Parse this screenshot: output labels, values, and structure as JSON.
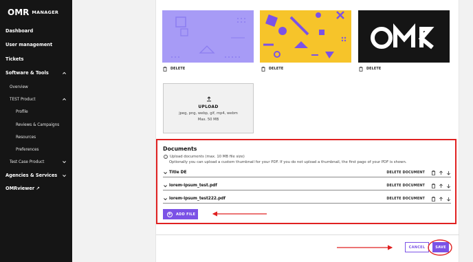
{
  "brand": {
    "mark": "OMR",
    "sub": "MANAGER"
  },
  "sidebar": {
    "items": [
      {
        "label": "Dashboard"
      },
      {
        "label": "User management"
      },
      {
        "label": "Tickets"
      },
      {
        "label": "Software & Tools"
      },
      {
        "label": "Overview"
      },
      {
        "label": "TEST Product"
      },
      {
        "label": "Profile"
      },
      {
        "label": "Reviews & Campaigns"
      },
      {
        "label": "Resources"
      },
      {
        "label": "Preferences"
      },
      {
        "label": "Test Case Product"
      },
      {
        "label": "Agencies & Services"
      },
      {
        "label": "OMRviewer ↗"
      }
    ]
  },
  "media": {
    "delete_label": "DELETE",
    "thumbs": [
      {
        "name": "purple-pattern",
        "color": "#a79bf6"
      },
      {
        "name": "yellow-pattern",
        "color": "#f6c42a"
      },
      {
        "name": "omr-logo",
        "color": "#111111",
        "logo_text": "OMR"
      }
    ],
    "upload": {
      "title": "UPLOAD",
      "types": "jpeg, png, webp, gif, mp4, webm",
      "max": "Max. 50 MB"
    }
  },
  "documents": {
    "title": "Documents",
    "info_line1": "Upload documents (max. 10 MB file size)",
    "info_line2": "Optionally you can upload a custom thumbnail for your PDF. If you do not upload a thumbnail, the first page of your PDF is shown.",
    "delete_label": "DELETE DOCUMENT",
    "rows": [
      {
        "name": "Title DE"
      },
      {
        "name": "lorem-ipsum_test.pdf"
      },
      {
        "name": "lorem-ipsum_test222.pdf"
      }
    ],
    "add_file_label": "ADD FILE"
  },
  "footer": {
    "cancel_label": "CANCEL",
    "save_label": "SAVE"
  },
  "colors": {
    "accent": "#7b52e6",
    "highlight": "#e02020",
    "sidebar": "#151515"
  }
}
